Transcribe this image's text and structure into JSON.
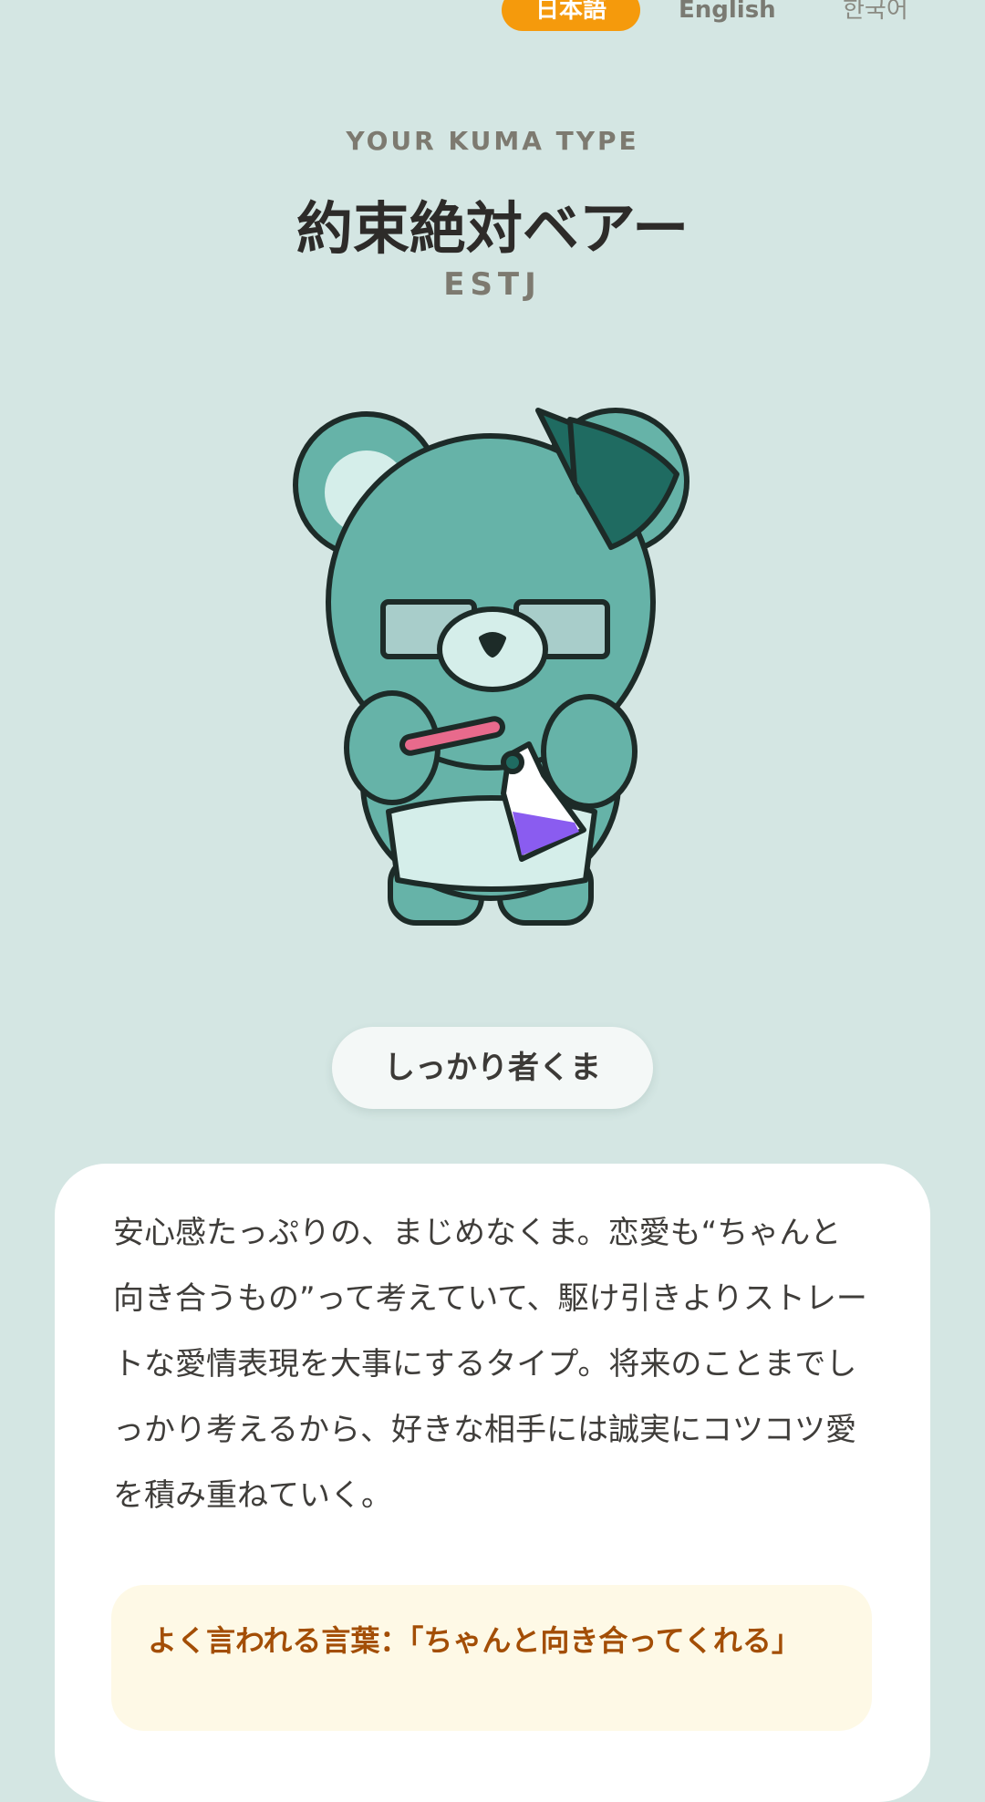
{
  "languages": [
    {
      "label": "日本語",
      "active": true
    },
    {
      "label": "English",
      "active": false
    },
    {
      "label": "한국어",
      "active": false
    }
  ],
  "result": {
    "eyebrow": "YOUR KUMA TYPE",
    "title": "約束絶対ベアー",
    "type_code": "ESTJ",
    "nickname": "しっかり者くま"
  },
  "description": "安心感たっぷりの、まじめなくま。恋愛も“ちゃんと向き合うもの”って考えていて、駆け引きよりストレートな愛情表現を大事にするタイプ。将来のことまでしっかり考えるから、好きな相手には誠実にコツコツ愛を積み重ねていく。",
  "quote": "よく言われる言葉：「ちゃんと向き合ってくれる」",
  "illustration": {
    "name": "teal-bear-with-glasses-and-flask",
    "colors": {
      "fur": "#66b3a8",
      "bow": "#1f6b61",
      "apron": "#d5eeea",
      "flask_liquid": "#8a5cf0",
      "tube": "#e86a8c"
    }
  },
  "colors": {
    "background": "#d4e6e3",
    "accent": "#f59a0c",
    "quote_text": "#a34e06",
    "quote_bg": "#fef9e6"
  }
}
